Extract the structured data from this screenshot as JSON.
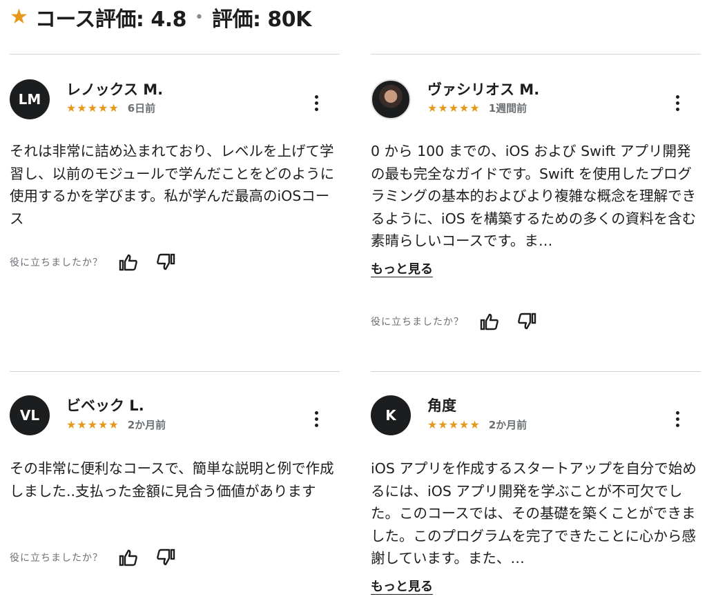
{
  "header": {
    "star": "★",
    "rating_label": "コース評価: 4.8",
    "separator": "•",
    "count_label": "評価: 80K"
  },
  "colors": {
    "star": "#e59819",
    "text": "#1c1d1f",
    "muted": "#6a6f73",
    "rule": "#d1d2d6"
  },
  "reviews": [
    {
      "initials": "LM",
      "name": "レノックス M.",
      "stars": "★★★★★",
      "time": "6日前",
      "text": "それは非常に詰め込まれており、レベルを上げて学習し、以前のモジュールで学んだことをどのように使用するかを学びます。私が学んだ最高のiOSコース",
      "helpful": "役に立ちましたか？"
    },
    {
      "initials": "",
      "name": "ヴァシリオス M.",
      "stars": "★★★★★",
      "time": "1週間前",
      "text": "0 から 100 までの、iOS および Swift アプリ開発の最も完全なガイドです。Swift を使用したプログラミングの基本的およびより複雑な概念を理解できるように、iOS を構築するための多くの資料を含む素晴らしいコースです。ま…",
      "more": "もっと見る",
      "helpful": "役に立ちましたか？"
    },
    {
      "initials": "VL",
      "name": "ビベック L.",
      "stars": "★★★★★",
      "time": "2か月前",
      "text": "その非常に便利なコースで、簡単な説明と例で作成しました..支払った金額に見合う価値があります",
      "helpful": "役に立ちましたか？"
    },
    {
      "initials": "K",
      "name": "角度",
      "stars": "★★★★★",
      "time": "2か月前",
      "text": "iOS アプリを作成するスタートアップを自分で始めるには、iOS アプリ開発を学ぶことが不可欠でした。このコースでは、その基礎を築くことができました。このプログラムを完了できたことに心から感謝しています。また、…",
      "more": "もっと見る"
    }
  ]
}
